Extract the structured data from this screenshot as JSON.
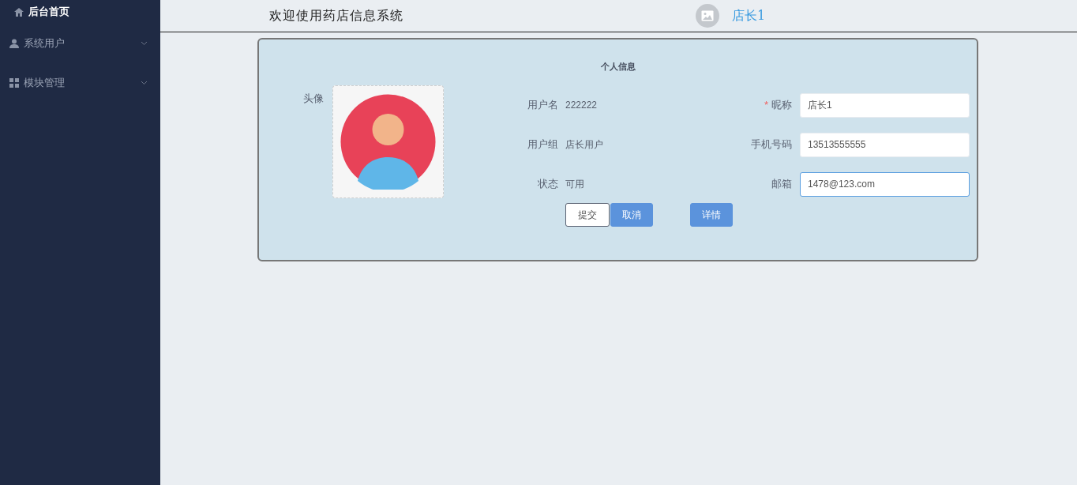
{
  "sidebar": {
    "items": [
      {
        "label": "后台首页",
        "selected": true,
        "has_submenu": false
      },
      {
        "label": "系统用户",
        "selected": false,
        "has_submenu": true
      },
      {
        "label": "模块管理",
        "selected": false,
        "has_submenu": true
      }
    ]
  },
  "header": {
    "title": "欢迎使用药店信息系统",
    "user_name": "店长1"
  },
  "profile": {
    "title": "个人信息",
    "avatar_label": "头像",
    "info": [
      {
        "label": "用户名",
        "value": "222222"
      },
      {
        "label": "用户组",
        "value": "店长用户"
      },
      {
        "label": "状态",
        "value": "可用"
      }
    ],
    "fields": [
      {
        "label": "昵称",
        "value": "店长1",
        "required_mark": "*",
        "focused": false
      },
      {
        "label": "手机号码",
        "value": "13513555555",
        "focused": false
      },
      {
        "label": "邮箱",
        "value": "1478@123.com",
        "focused": true
      }
    ],
    "buttons": [
      {
        "label": "提交",
        "kind": "plain"
      },
      {
        "label": "取消",
        "kind": "primary"
      },
      {
        "label": "详情",
        "kind": "primary"
      }
    ]
  }
}
